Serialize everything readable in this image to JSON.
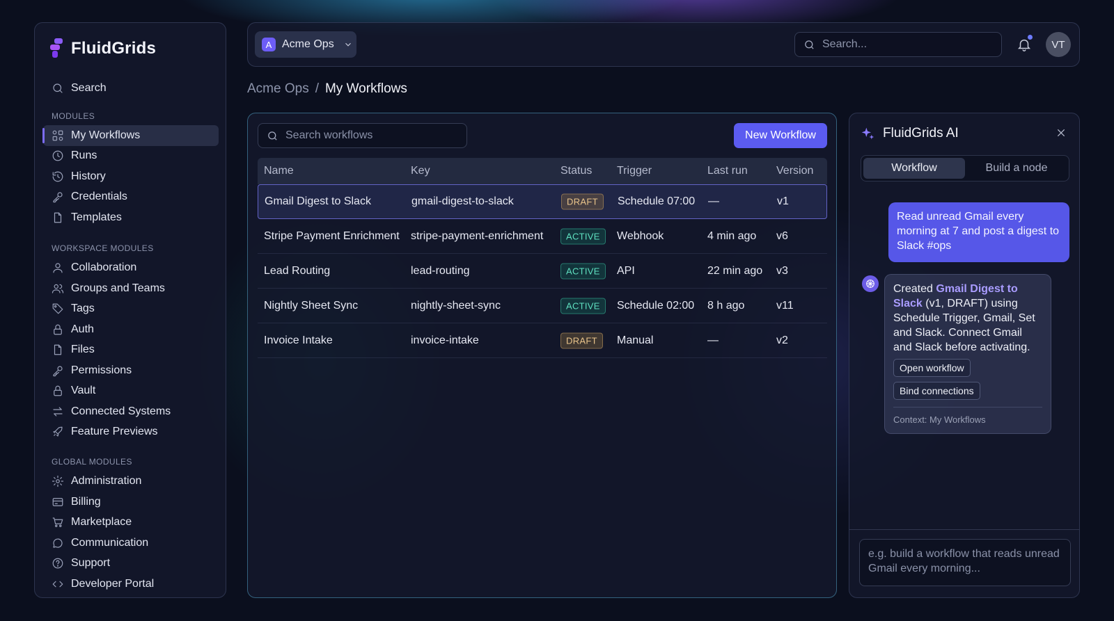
{
  "app": {
    "name": "FluidGrids"
  },
  "sidebar": {
    "search_label": "Search",
    "sections": {
      "modules": "MODULES",
      "workspace": "WORKSPACE MODULES",
      "global": "GLOBAL MODULES"
    },
    "modules": [
      {
        "label": "My Workflows",
        "icon": "workflow-icon",
        "active": true
      },
      {
        "label": "Runs",
        "icon": "clock-icon"
      },
      {
        "label": "History",
        "icon": "history-icon"
      },
      {
        "label": "Credentials",
        "icon": "key-icon"
      },
      {
        "label": "Templates",
        "icon": "file-icon"
      }
    ],
    "workspace_modules": [
      {
        "label": "Collaboration",
        "icon": "user-icon"
      },
      {
        "label": "Groups and Teams",
        "icon": "users-icon"
      },
      {
        "label": "Tags",
        "icon": "tag-icon"
      },
      {
        "label": "Auth",
        "icon": "lock-icon"
      },
      {
        "label": "Files",
        "icon": "file-icon"
      },
      {
        "label": "Permissions",
        "icon": "key-icon"
      },
      {
        "label": "Vault",
        "icon": "lock-icon"
      },
      {
        "label": "Connected Systems",
        "icon": "arrows-icon"
      },
      {
        "label": "Feature Previews",
        "icon": "rocket-icon"
      }
    ],
    "global_modules": [
      {
        "label": "Administration",
        "icon": "gear-icon"
      },
      {
        "label": "Billing",
        "icon": "card-icon"
      },
      {
        "label": "Marketplace",
        "icon": "cart-icon"
      },
      {
        "label": "Communication",
        "icon": "chat-icon"
      },
      {
        "label": "Support",
        "icon": "help-icon"
      },
      {
        "label": "Developer Portal",
        "icon": "code-icon"
      }
    ]
  },
  "topbar": {
    "org_initial": "A",
    "org_name": "Acme Ops",
    "search_placeholder": "Search...",
    "avatar_initials": "VT"
  },
  "breadcrumb": {
    "parent": "Acme Ops",
    "separator": "/",
    "current": "My Workflows"
  },
  "workflows": {
    "search_placeholder": "Search workflows",
    "new_button": "New Workflow",
    "columns": [
      "Name",
      "Key",
      "Status",
      "Trigger",
      "Last run",
      "Version"
    ],
    "rows": [
      {
        "name": "Gmail Digest to Slack",
        "key": "gmail-digest-to-slack",
        "status": "DRAFT",
        "trigger": "Schedule 07:00",
        "last_run": "—",
        "version": "v1"
      },
      {
        "name": "Stripe Payment Enrichment",
        "key": "stripe-payment-enrichment",
        "status": "ACTIVE",
        "trigger": "Webhook",
        "last_run": "4 min ago",
        "version": "v6"
      },
      {
        "name": "Lead Routing",
        "key": "lead-routing",
        "status": "ACTIVE",
        "trigger": "API",
        "last_run": "22 min ago",
        "version": "v3"
      },
      {
        "name": "Nightly Sheet Sync",
        "key": "nightly-sheet-sync",
        "status": "ACTIVE",
        "trigger": "Schedule 02:00",
        "last_run": "8 h ago",
        "version": "v11"
      },
      {
        "name": "Invoice Intake",
        "key": "invoice-intake",
        "status": "DRAFT",
        "trigger": "Manual",
        "last_run": "—",
        "version": "v2"
      }
    ]
  },
  "ai": {
    "title": "FluidGrids AI",
    "tabs": [
      "Workflow",
      "Build a node"
    ],
    "user_message": "Read unread Gmail every morning at 7 and post a digest to Slack #ops",
    "bot_prefix": "Created ",
    "bot_highlight": "Gmail Digest to Slack",
    "bot_suffix": " (v1, DRAFT) using Schedule Trigger, Gmail, Set and Slack. Connect Gmail and Slack before activating.",
    "action_open": "Open workflow",
    "action_bind": "Bind connections",
    "context": "Context: My Workflows",
    "input_placeholder": "e.g. build a workflow that reads unread Gmail every morning..."
  },
  "colors": {
    "accent": "#5b5bf0",
    "draft": "#e8c38a",
    "active": "#5fe0c0",
    "background": "#0b0f1e"
  }
}
